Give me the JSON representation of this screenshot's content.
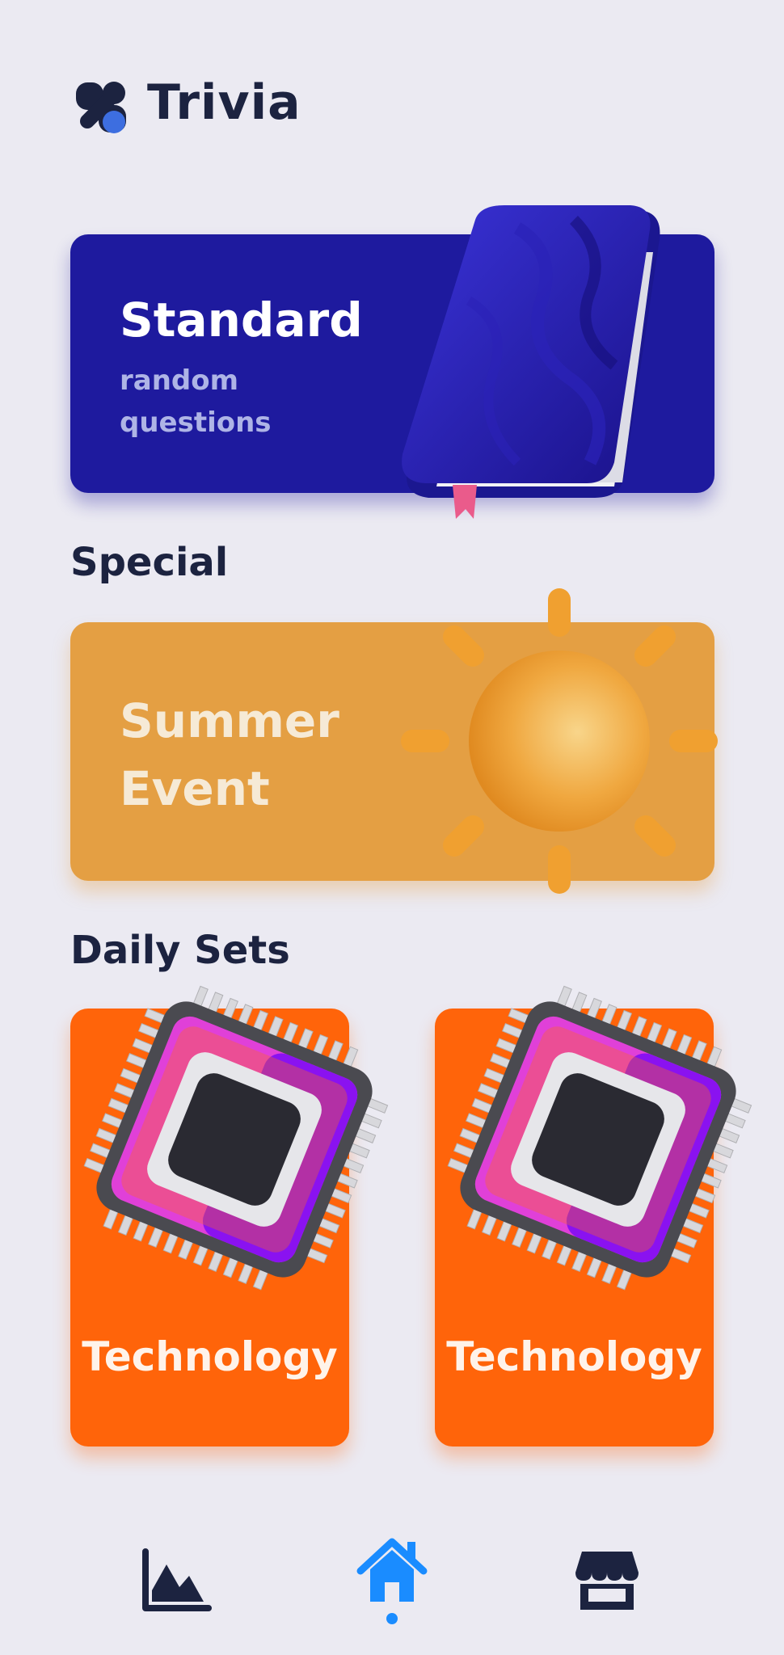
{
  "header": {
    "app_title": "Trivia"
  },
  "standard_card": {
    "title": "Standard",
    "subtitle": "random questions"
  },
  "sections": {
    "special": "Special",
    "daily_sets": "Daily Sets"
  },
  "special_card": {
    "title": "Summer Event"
  },
  "daily_cards": [
    {
      "label": "Technology"
    },
    {
      "label": "Technology"
    }
  ],
  "nav": {
    "items": [
      {
        "icon": "chart-icon",
        "active": false
      },
      {
        "icon": "home-icon",
        "active": true
      },
      {
        "icon": "store-icon",
        "active": false
      }
    ],
    "active_color": "#1a8cff",
    "inactive_color": "#1c2340"
  },
  "colors": {
    "background": "#ebeaf2",
    "standard": "#1e1a9e",
    "summer": "#e49f43",
    "technology": "#ff640a"
  }
}
